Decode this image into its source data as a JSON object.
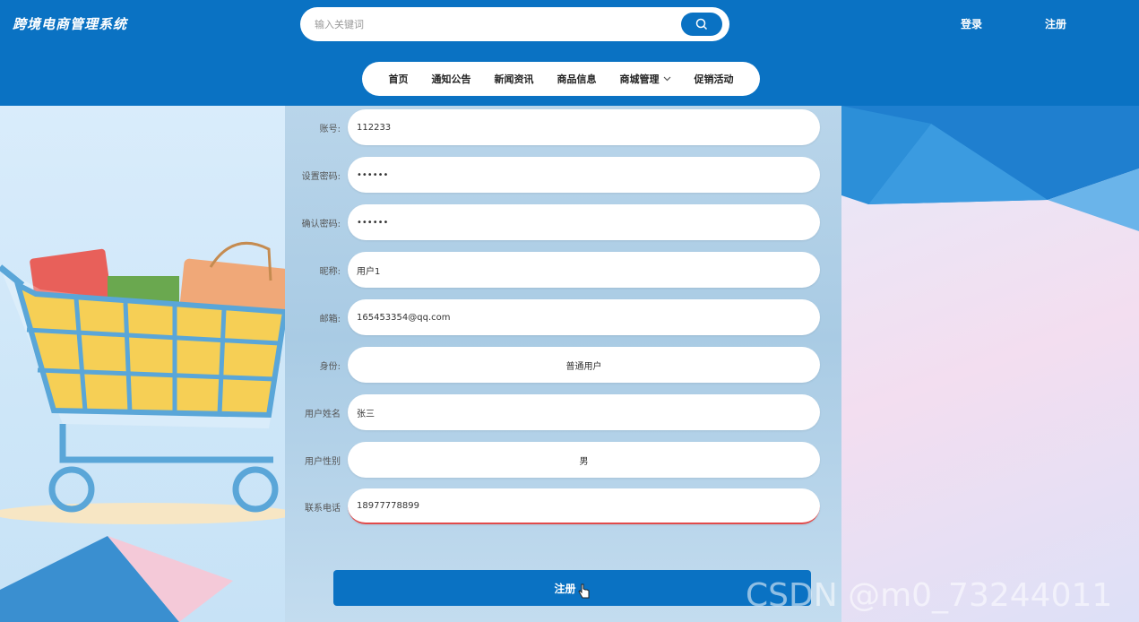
{
  "header": {
    "logo": "跨境电商管理系统",
    "search_placeholder": "输入关键词",
    "login": "登录",
    "register": "注册"
  },
  "nav": {
    "items": [
      {
        "label": "首页"
      },
      {
        "label": "通知公告"
      },
      {
        "label": "新闻资讯"
      },
      {
        "label": "商品信息"
      },
      {
        "label": "商城管理"
      },
      {
        "label": "促销活动"
      }
    ]
  },
  "form": {
    "account": {
      "label": "账号:",
      "value": "112233"
    },
    "password": {
      "label": "设置密码:",
      "value": "••••••"
    },
    "confirm": {
      "label": "确认密码:",
      "value": "••••••"
    },
    "nickname": {
      "label": "昵称:",
      "value": "用户1"
    },
    "email": {
      "label": "邮箱:",
      "value": "165453354@qq.com"
    },
    "identity": {
      "label": "身份:",
      "value": "普通用户"
    },
    "realname": {
      "label": "用户姓名",
      "value": "张三"
    },
    "gender": {
      "label": "用户性别",
      "value": "男"
    },
    "phone": {
      "label": "联系电话",
      "value": "18977778899"
    },
    "submit": "注册"
  },
  "watermark": "CSDN @m0_73244011",
  "colors": {
    "primary": "#0a72c3",
    "accent_red": "#e14b4b"
  }
}
